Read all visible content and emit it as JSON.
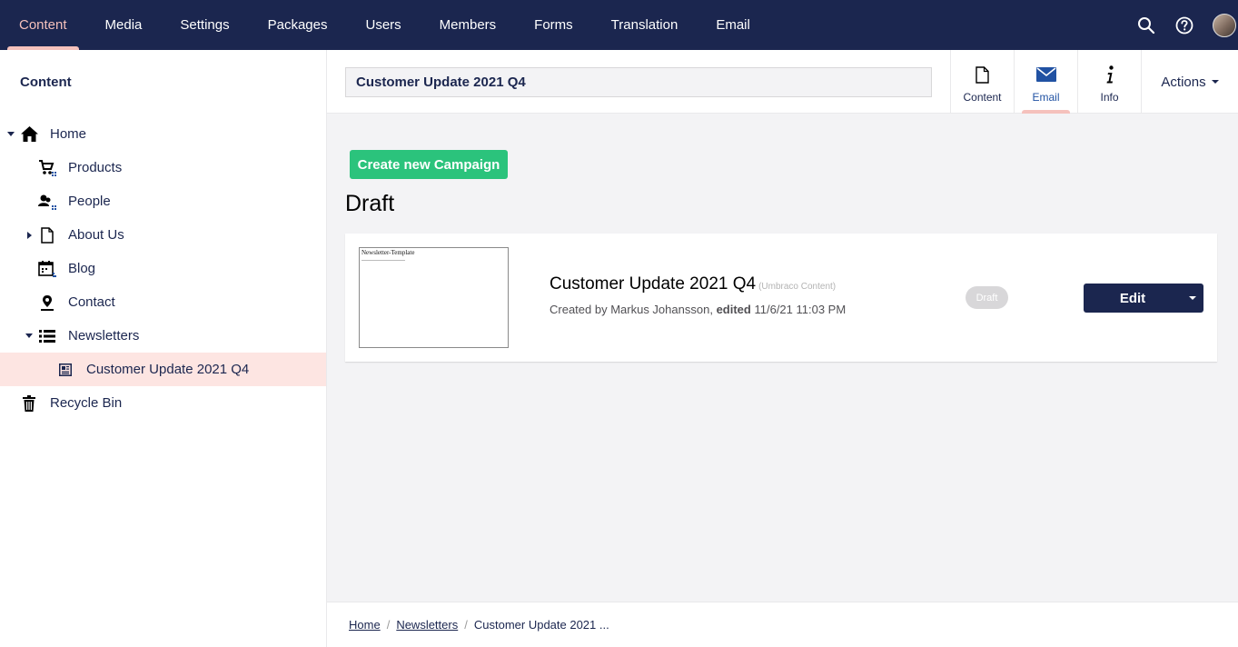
{
  "nav": {
    "items": [
      {
        "label": "Content",
        "active": true
      },
      {
        "label": "Media"
      },
      {
        "label": "Settings"
      },
      {
        "label": "Packages"
      },
      {
        "label": "Users"
      },
      {
        "label": "Members"
      },
      {
        "label": "Forms"
      },
      {
        "label": "Translation"
      },
      {
        "label": "Email"
      }
    ],
    "icons": [
      "search-icon",
      "help-icon",
      "user-avatar"
    ]
  },
  "sidebar": {
    "title": "Content",
    "tree": [
      {
        "label": "Home",
        "icon": "home-icon",
        "expanded": true
      },
      {
        "label": "Products",
        "icon": "cart-icon"
      },
      {
        "label": "People",
        "icon": "people-icon"
      },
      {
        "label": "About Us",
        "icon": "document-icon",
        "collapsed": true
      },
      {
        "label": "Blog",
        "icon": "calendar-icon"
      },
      {
        "label": "Contact",
        "icon": "location-icon"
      },
      {
        "label": "Newsletters",
        "icon": "list-icon",
        "expanded": true
      },
      {
        "label": "Customer Update 2021 Q4",
        "icon": "newspaper-icon",
        "selected": true
      },
      {
        "label": "Recycle Bin",
        "icon": "trash-icon"
      }
    ]
  },
  "header": {
    "name_value": "Customer Update 2021 Q4",
    "apps": [
      {
        "label": "Content",
        "icon": "document-icon"
      },
      {
        "label": "Email",
        "icon": "envelope-icon",
        "active": true
      },
      {
        "label": "Info",
        "icon": "info-icon"
      }
    ],
    "actions_label": "Actions"
  },
  "main": {
    "create_button_label": "Create new Campaign",
    "section_title": "Draft",
    "card": {
      "thumbnail_title": "Newsletter-Template",
      "title": "Customer Update 2021 Q4",
      "type": "(Umbraco Content)",
      "meta_prefix": "Created by Markus Johansson,",
      "meta_edited_label": "edited",
      "meta_date": "11/6/21 11:03 PM",
      "status_badge": "Draft",
      "edit_label": "Edit"
    }
  },
  "breadcrumb": {
    "items": [
      "Home",
      "Newsletters"
    ],
    "current": "Customer Update 2021 ..."
  },
  "colors": {
    "nav_bg": "#1b264f",
    "accent_pink": "#f5c1bc",
    "selected_row": "#fde5e2",
    "create_green": "#2bc37c",
    "link_blue": "#2152a3"
  }
}
